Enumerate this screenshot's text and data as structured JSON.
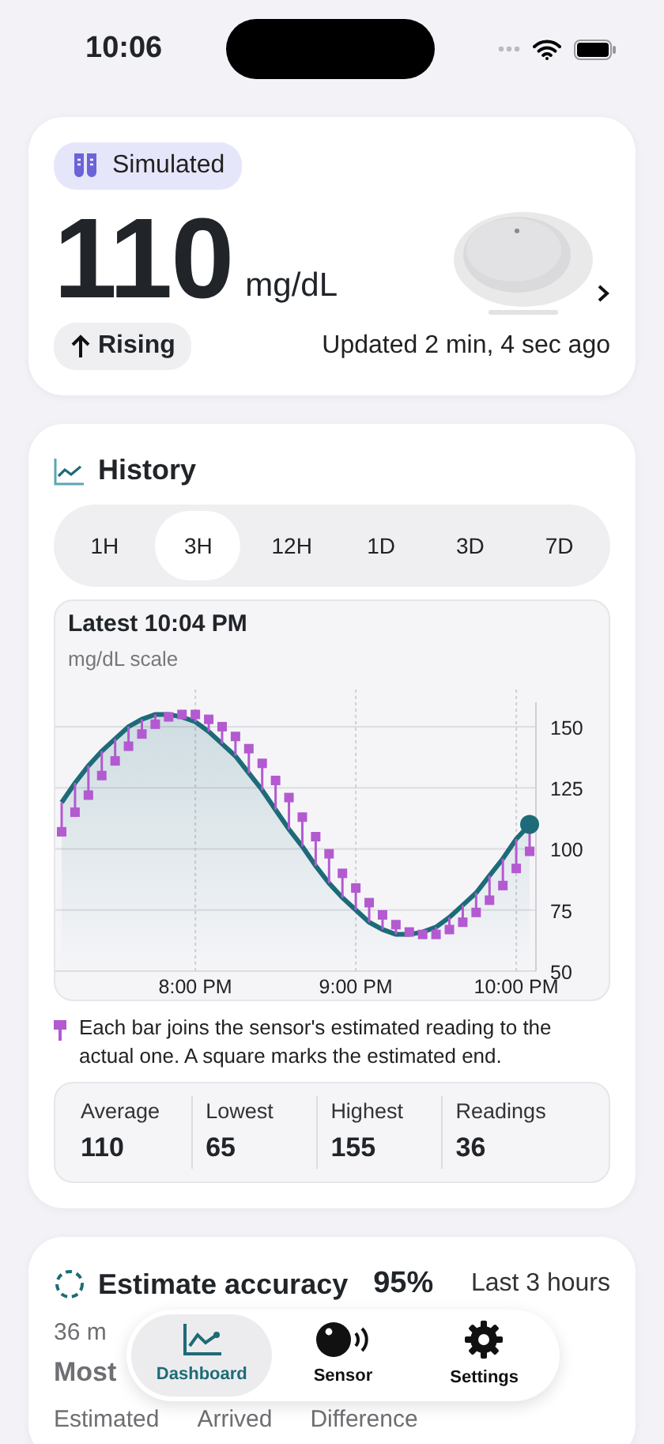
{
  "status_bar": {
    "time": "10:06"
  },
  "reading_card": {
    "badge": "Simulated",
    "value": "110",
    "unit": "mg/dL",
    "trend": "Rising",
    "updated": "Updated 2 min, 4 sec ago"
  },
  "history": {
    "title": "History",
    "ranges": [
      {
        "label": "1H",
        "selected": false
      },
      {
        "label": "3H",
        "selected": true
      },
      {
        "label": "12H",
        "selected": false
      },
      {
        "label": "1D",
        "selected": false
      },
      {
        "label": "3D",
        "selected": false
      },
      {
        "label": "7D",
        "selected": false
      }
    ],
    "latest": "Latest 10:04 PM",
    "scale": "mg/dL scale",
    "chart_data": {
      "type": "area",
      "grid": true,
      "categories": [
        null,
        null,
        null,
        null,
        null,
        null,
        null,
        null,
        null,
        null,
        "8:00 PM",
        null,
        null,
        null,
        null,
        null,
        null,
        null,
        null,
        null,
        null,
        null,
        "9:00 PM",
        null,
        null,
        null,
        null,
        null,
        null,
        null,
        null,
        null,
        null,
        null,
        "10:00 PM",
        null
      ],
      "ylim": [
        50,
        160
      ],
      "yticks": [
        50,
        75,
        100,
        125,
        150
      ],
      "series": [
        {
          "color": "#1d6b78",
          "values": [
            119,
            127,
            134,
            140,
            145,
            150,
            153,
            155,
            155,
            154,
            152,
            148,
            143,
            138,
            131,
            124,
            116,
            108,
            101,
            93,
            86,
            80,
            75,
            70,
            67,
            65,
            65,
            66,
            68,
            72,
            77,
            82,
            89,
            96,
            104,
            110
          ]
        },
        {
          "type": "scatter",
          "color": "#b35ad0",
          "marker": "square",
          "values": [
            107,
            115,
            122,
            130,
            136,
            142,
            147,
            151,
            154,
            155,
            155,
            153,
            150,
            146,
            141,
            135,
            128,
            121,
            113,
            105,
            98,
            90,
            84,
            78,
            73,
            69,
            66,
            65,
            65,
            67,
            70,
            74,
            79,
            85,
            92,
            99
          ]
        }
      ]
    },
    "legend": "Each bar joins the sensor's estimated reading to the actual one. A square marks the estimated end.",
    "stats": [
      {
        "label": "Average",
        "value": "110"
      },
      {
        "label": "Lowest",
        "value": "65"
      },
      {
        "label": "Highest",
        "value": "155"
      },
      {
        "label": "Readings",
        "value": "36"
      }
    ]
  },
  "accuracy_card": {
    "title": "Estimate accuracy",
    "percent": "95%",
    "period": "Last 3 hours",
    "line_1": "36 m",
    "line_2": "Most",
    "columns": [
      "Estimated",
      "Arrived",
      "Difference"
    ]
  },
  "tab_bar": [
    {
      "kind": "dashboard",
      "label": "Dashboard",
      "selected": true
    },
    {
      "kind": "sensor",
      "label": "Sensor",
      "selected": false
    },
    {
      "kind": "settings",
      "label": "Settings",
      "selected": false
    }
  ]
}
